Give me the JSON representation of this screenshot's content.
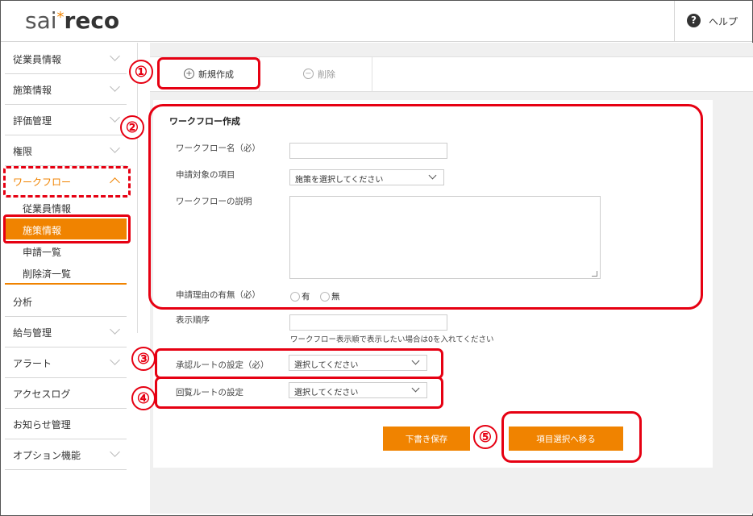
{
  "header": {
    "logo": {
      "sai": "sai",
      "star": "*",
      "reco": "reco"
    },
    "help_label": "ヘルプ",
    "help_icon": "question-circle-icon"
  },
  "sidebar": {
    "items": [
      {
        "label": "従業員情報"
      },
      {
        "label": "施策情報"
      },
      {
        "label": "評価管理"
      },
      {
        "label": "権限"
      },
      {
        "label": "ワークフロー",
        "expanded": true
      },
      {
        "label": "分析"
      },
      {
        "label": "給与管理"
      },
      {
        "label": "アラート"
      },
      {
        "label": "アクセスログ"
      },
      {
        "label": "お知らせ管理"
      },
      {
        "label": "オプション機能"
      }
    ],
    "workflow_sub": [
      {
        "label": "従業員情報"
      },
      {
        "label": "施策情報",
        "selected": true
      },
      {
        "label": "申請一覧"
      },
      {
        "label": "削除済一覧"
      }
    ]
  },
  "toolbar": {
    "new_label": "新規作成",
    "delete_label": "削除"
  },
  "form": {
    "title": "ワークフロー作成",
    "name_label": "ワークフロー名（必）",
    "name_value": "",
    "target_label": "申請対象の項目",
    "target_value": "施策を選択してください",
    "desc_label": "ワークフローの説明",
    "desc_value": "",
    "reason_label": "申請理由の有無（必）",
    "reason_yes": "有",
    "reason_no": "無",
    "order_label": "表示順序",
    "order_value": "",
    "order_hint": "ワークフロー表示順で表示したい場合は0を入れてください",
    "approval_label": "承認ルートの設定（必）",
    "approval_value": "選択してください",
    "circulation_label": "回覧ルートの設定",
    "circulation_value": "選択してください",
    "draft_button": "下書き保存",
    "next_button": "項目選択へ移る"
  },
  "annotations": [
    "①",
    "②",
    "③",
    "④",
    "⑤"
  ],
  "colors": {
    "accent": "#f08300",
    "annotation": "#e60012"
  }
}
